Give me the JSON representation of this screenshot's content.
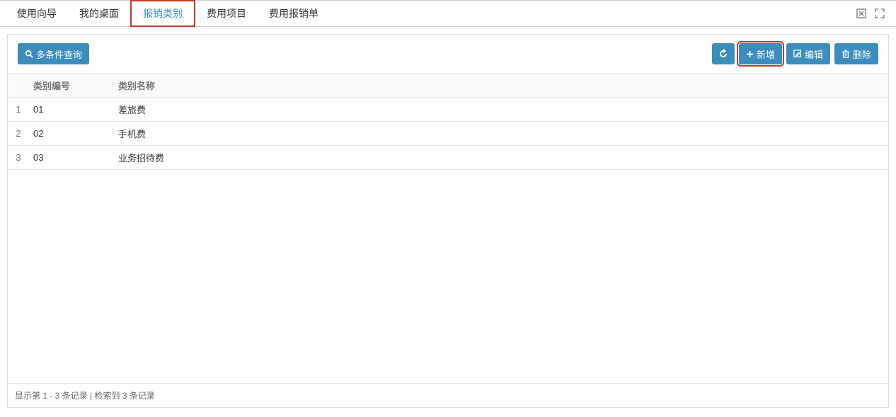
{
  "tabs": [
    {
      "label": "使用向导",
      "active": false
    },
    {
      "label": "我的桌面",
      "active": false
    },
    {
      "label": "报销类别",
      "active": true
    },
    {
      "label": "费用项目",
      "active": false
    },
    {
      "label": "费用报销单",
      "active": false
    }
  ],
  "toolbar": {
    "multi_query": "多条件查询",
    "add": "新增",
    "edit": "编辑",
    "delete": "删除"
  },
  "table": {
    "headers": {
      "code": "类别编号",
      "name": "类别名称"
    },
    "rows": [
      {
        "idx": "1",
        "code": "01",
        "name": "差旅费"
      },
      {
        "idx": "2",
        "code": "02",
        "name": "手机费"
      },
      {
        "idx": "3",
        "code": "03",
        "name": "业务招待费"
      }
    ]
  },
  "footer": {
    "text": "显示第 1 - 3 条记录 | 检索到 3 条记录"
  }
}
